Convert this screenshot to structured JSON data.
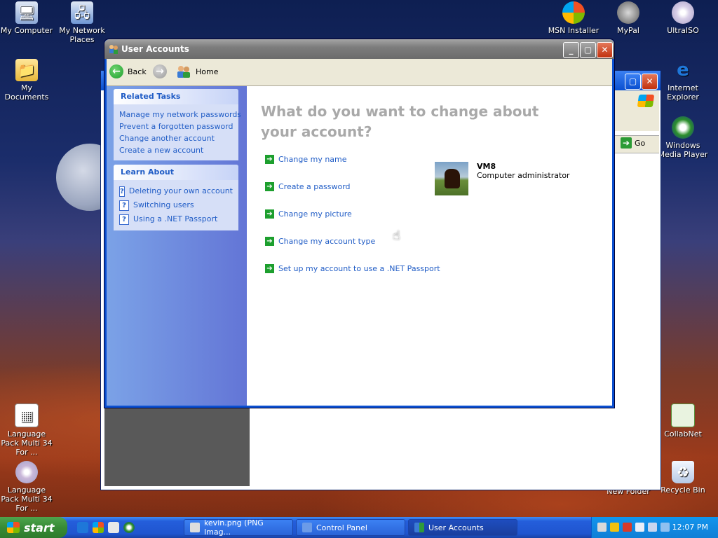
{
  "desktop": {
    "icons_left": [
      {
        "label": "My Computer",
        "icon": "my-computer-icon"
      },
      {
        "label": "My Network Places",
        "icon": "network-places-icon"
      },
      {
        "label": "My Documents",
        "icon": "documents-folder-icon"
      },
      {
        "label": "Language Pack Multi 34 For ...",
        "icon": "language-pack-icon"
      },
      {
        "label": "Language Pack Multi 34 For ...",
        "icon": "cd-icon"
      }
    ],
    "icons_right": [
      {
        "label": "MSN Installer",
        "icon": "msn-butterfly-icon"
      },
      {
        "label": "MyPal",
        "icon": "mypal-icon"
      },
      {
        "label": "UltraISO",
        "icon": "ultraiso-disc-icon"
      },
      {
        "label": "Internet Explorer",
        "icon": "internet-explorer-icon"
      },
      {
        "label": "Windows Media Player",
        "icon": "media-player-icon"
      },
      {
        "label": "CollabNet",
        "icon": "collabnet-icon"
      },
      {
        "label": "Recycle Bin",
        "icon": "recycle-bin-icon"
      },
      {
        "label": "New Folder",
        "icon": "folder-icon"
      }
    ]
  },
  "back_window": {
    "go_label": "Go"
  },
  "main_window": {
    "title": "User Accounts",
    "toolbar": {
      "back_label": "Back",
      "home_label": "Home"
    },
    "related_tasks": {
      "header": "Related Tasks",
      "links": [
        "Manage my network passwords",
        "Prevent a forgotten password",
        "Change another account",
        "Create a new account"
      ]
    },
    "learn_about": {
      "header": "Learn About",
      "links": [
        "Deleting your own account",
        "Switching users",
        "Using a .NET Passport"
      ]
    },
    "question": "What do you want to change about your account?",
    "options": [
      "Change my name",
      "Create a password",
      "Change my picture",
      "Change my account type",
      "Set up my account to use a .NET Passport"
    ],
    "account": {
      "name": "VM8",
      "role": "Computer administrator"
    }
  },
  "taskbar": {
    "start_label": "start",
    "tasks": [
      {
        "label": "kevin.png (PNG Imag...",
        "active": false
      },
      {
        "label": "Control Panel",
        "active": false
      },
      {
        "label": "User Accounts",
        "active": true
      }
    ],
    "clock": "12:07 PM"
  },
  "colors": {
    "link": "#215dc6",
    "taskpane": "#7ba2e7",
    "question": "#a9a9a9",
    "xp_blue": "#245edb",
    "start_green": "#378b35"
  }
}
